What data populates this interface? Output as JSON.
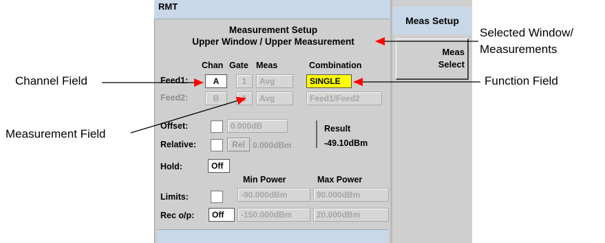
{
  "window": {
    "title": "RMT",
    "status": ""
  },
  "setup": {
    "heading_line1": "Measurement Setup",
    "heading_line2": "Upper Window / Upper Measurement",
    "columns": {
      "chan": "Chan",
      "gate": "Gate",
      "meas": "Meas",
      "combination": "Combination"
    },
    "feed1": {
      "label": "Feed1:",
      "chan": "A",
      "gate": "1",
      "meas": "Avg",
      "combination": "SINGLE"
    },
    "feed2": {
      "label": "Feed2:",
      "chan": "B",
      "gate": "1",
      "meas": "Avg",
      "combination": "Feed1/Feed2"
    },
    "offset": {
      "label": "Offset:",
      "value": "0.000dB"
    },
    "relative": {
      "label": "Relative:",
      "button": "Rel",
      "value": "0.000dBm"
    },
    "result": {
      "label": "Result",
      "value": "-49.10dBm"
    },
    "hold": {
      "label": "Hold:",
      "value": "Off"
    },
    "limits": {
      "label": "Limits:",
      "min_header": "Min Power",
      "max_header": "Max Power",
      "min": "-90.000dBm",
      "max": "90.000dBm"
    },
    "rec_op": {
      "label": "Rec o/p:",
      "value": "Off",
      "min": "-150.000dBm",
      "max": "20.000dBm"
    }
  },
  "softkeys": {
    "title": "Meas Setup",
    "meas_select_line1": "Meas",
    "meas_select_line2": "Select"
  },
  "callouts": {
    "selected_window_line1": "Selected Window/",
    "selected_window_line2": "Measurements",
    "channel_field": "Channel Field",
    "function_field": "Function Field",
    "measurement_field": "Measurement Field"
  },
  "colors": {
    "title_bar": "#c8d8e8",
    "panel": "#cfcfcf",
    "highlight": "#ffff00",
    "arrow": "#ff0000"
  }
}
